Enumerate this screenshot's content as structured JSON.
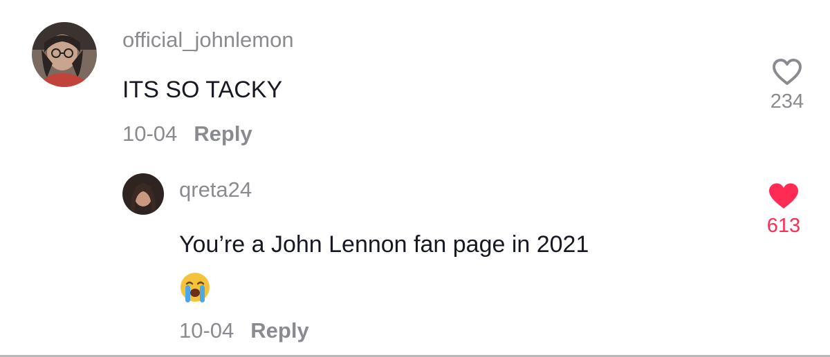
{
  "comment": {
    "username": "official_johnlemon",
    "text": "ITS SO TACKY",
    "date": "10-04",
    "reply_label": "Reply",
    "like_count": "234",
    "liked": false
  },
  "reply": {
    "username": "qreta24",
    "text": "You’re a John Lennon fan page in 2021",
    "emoji": "loudly-crying-face",
    "date": "10-04",
    "reply_label": "Reply",
    "like_count": "613",
    "liked": true
  },
  "colors": {
    "username": "#8a8b91",
    "text": "#161823",
    "like_active": "#fe2c55",
    "like_inactive": "#8a8b91"
  }
}
